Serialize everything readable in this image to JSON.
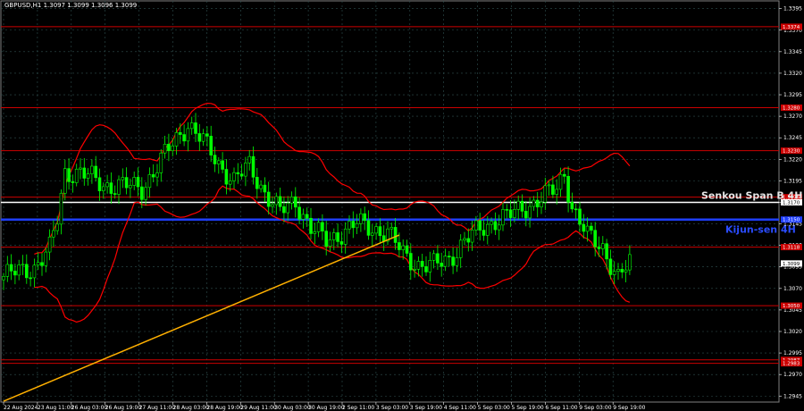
{
  "header": {
    "symbol_text": "GBPUSD,H1  1.3097 1.3099 1.3096 1.3099"
  },
  "colors": {
    "background": "#000000",
    "grid": "#2f4f4f",
    "candle": "#00ff00",
    "bands": "#ff0000",
    "levels": "#cc0000",
    "senkou": "#ffffff",
    "kijun": "#1f3fff",
    "trend": "#ffb000",
    "label_white": "#e6e6e6",
    "label_blue": "#2a4cff"
  },
  "chart_data": {
    "type": "candlestick",
    "title": "GBPUSD,H1  1.3097 1.3099 1.3096 1.3099",
    "ylim": [
      1.2938,
      1.3404
    ],
    "y_ticks": [
      "1.3395",
      "1.3370",
      "1.3345",
      "1.3320",
      "1.3295",
      "1.3270",
      "1.3245",
      "1.3220",
      "1.3195",
      "1.3170",
      "1.3145",
      "1.3120",
      "1.3095",
      "1.3070",
      "1.3045",
      "1.3020",
      "1.2995",
      "1.2970",
      "1.2945"
    ],
    "x_ticks": [
      "22 Aug 2024",
      "23 Aug 11:00",
      "26 Aug 03:00",
      "26 Aug 19:00",
      "27 Aug 11:00",
      "28 Aug 03:00",
      "28 Aug 19:00",
      "29 Aug 11:00",
      "30 Aug 03:00",
      "30 Aug 19:00",
      "2 Sep 11:00",
      "3 Sep 03:00",
      "3 Sep 19:00",
      "4 Sep 11:00",
      "5 Sep 03:00",
      "5 Sep 19:00",
      "6 Sep 11:00",
      "9 Sep 03:00",
      "9 Sep 19:00"
    ],
    "horizontal_levels": [
      {
        "price": 1.3374,
        "label": "1.3374"
      },
      {
        "price": 1.328,
        "label": "1.3280"
      },
      {
        "price": 1.323,
        "label": "1.3230"
      },
      {
        "price": 1.3176,
        "label": "1.3176"
      },
      {
        "price": 1.3118,
        "label": "1.3118"
      },
      {
        "price": 1.305,
        "label": "1.3050"
      },
      {
        "price": 1.2987,
        "label": "1.2987"
      },
      {
        "price": 1.2983,
        "label": "1.2983"
      }
    ],
    "senkou_span_b": {
      "price": 1.317,
      "label": "Senkou Span B 4H",
      "tag": "1.3170"
    },
    "kijun_sen": {
      "price": 1.315,
      "label": "Kijun-sen 4H",
      "tag": "1.3150"
    },
    "current_price": {
      "price": 1.3099,
      "tag": "1.3099"
    },
    "trend_line": {
      "from": {
        "bar": 0,
        "price": 1.2939
      },
      "to": {
        "bar": 103,
        "price": 1.3132
      }
    },
    "close_path": [
      [
        0,
        1.3084
      ],
      [
        8,
        1.3095
      ],
      [
        12,
        1.3115
      ],
      [
        14,
        1.315
      ],
      [
        16,
        1.3205
      ],
      [
        20,
        1.3205
      ],
      [
        26,
        1.319
      ],
      [
        30,
        1.319
      ],
      [
        36,
        1.3186
      ],
      [
        42,
        1.3225
      ],
      [
        48,
        1.3262
      ],
      [
        52,
        1.324
      ],
      [
        56,
        1.3215
      ],
      [
        60,
        1.3195
      ],
      [
        64,
        1.3212
      ],
      [
        68,
        1.3182
      ],
      [
        72,
        1.3158
      ],
      [
        76,
        1.3172
      ],
      [
        80,
        1.314
      ],
      [
        84,
        1.3125
      ],
      [
        88,
        1.3135
      ],
      [
        92,
        1.3145
      ],
      [
        96,
        1.314
      ],
      [
        100,
        1.3135
      ],
      [
        104,
        1.311
      ],
      [
        108,
        1.3098
      ],
      [
        112,
        1.3096
      ],
      [
        116,
        1.3105
      ],
      [
        120,
        1.3125
      ],
      [
        124,
        1.3138
      ],
      [
        128,
        1.315
      ],
      [
        132,
        1.3155
      ],
      [
        136,
        1.3165
      ],
      [
        140,
        1.3175
      ],
      [
        144,
        1.3185
      ],
      [
        146,
        1.3205
      ],
      [
        148,
        1.3165
      ],
      [
        152,
        1.313
      ],
      [
        156,
        1.3118
      ],
      [
        160,
        1.3082
      ],
      [
        163,
        1.3099
      ]
    ]
  }
}
